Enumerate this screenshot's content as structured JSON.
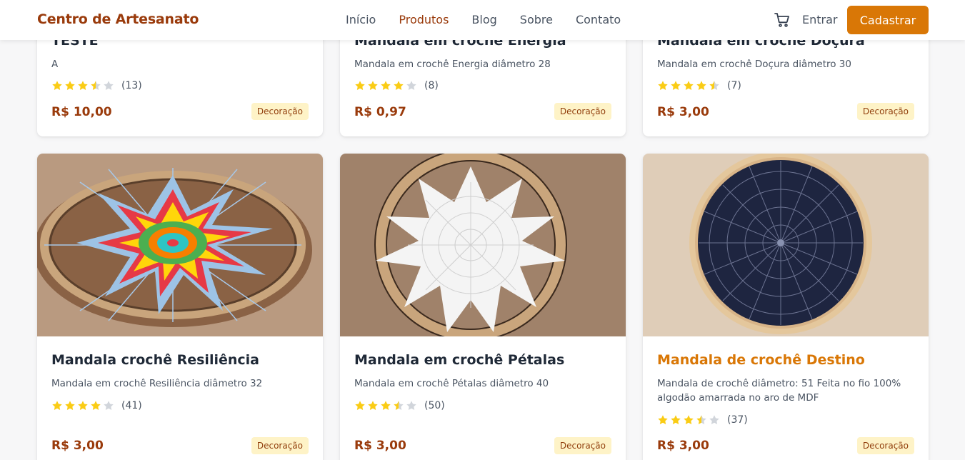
{
  "brand": "Centro de Artesanato",
  "nav": {
    "inicio": "Início",
    "produtos": "Produtos",
    "blog": "Blog",
    "sobre": "Sobre",
    "contato": "Contato"
  },
  "header": {
    "cart_icon": "shopping-cart-icon",
    "login": "Entrar",
    "signup": "Cadastrar"
  },
  "colors": {
    "brand": "#9a3b0c",
    "accent": "#d97706",
    "star": "#facc15",
    "star_empty": "#d1d5db",
    "badge_bg": "#fef3c7"
  },
  "products": [
    {
      "title": "TESTE",
      "description": "A",
      "rating": 3.5,
      "reviews": "(13)",
      "price": "R$ 10,00",
      "category": "Decoração"
    },
    {
      "title": "Mandala em crochê Energia",
      "description": "Mandala em crochê Energia diâmetro 28",
      "rating": 4,
      "reviews": "(8)",
      "price": "R$ 0,97",
      "category": "Decoração"
    },
    {
      "title": "Mandala em crochê Doçura",
      "description": "Mandala em crochê Doçura diâmetro 30",
      "rating": 4.5,
      "reviews": "(7)",
      "price": "R$ 3,00",
      "category": "Decoração"
    },
    {
      "title": "Mandala crochê Resiliência",
      "description": "Mandala em crochê Resiliência diâmetro 32",
      "rating": 4,
      "reviews": "(41)",
      "price": "R$ 3,00",
      "category": "Decoração",
      "image": "colorful-crochet-mandala-photo"
    },
    {
      "title": "Mandala em crochê Pétalas",
      "description": "Mandala em crochê Pétalas diâmetro 40",
      "rating": 3.5,
      "reviews": "(50)",
      "price": "R$ 3,00",
      "category": "Decoração",
      "image": "white-crochet-mandala-photo"
    },
    {
      "title": "Mandala de crochê Destino",
      "description": "Mandala de crochê diâmetro: 51 Feita no fio 100% algodão amarrada no aro de MDF",
      "rating": 3.5,
      "reviews": "(37)",
      "price": "R$ 3,00",
      "category": "Decoração",
      "image": "navy-crochet-mandala-photo"
    }
  ]
}
